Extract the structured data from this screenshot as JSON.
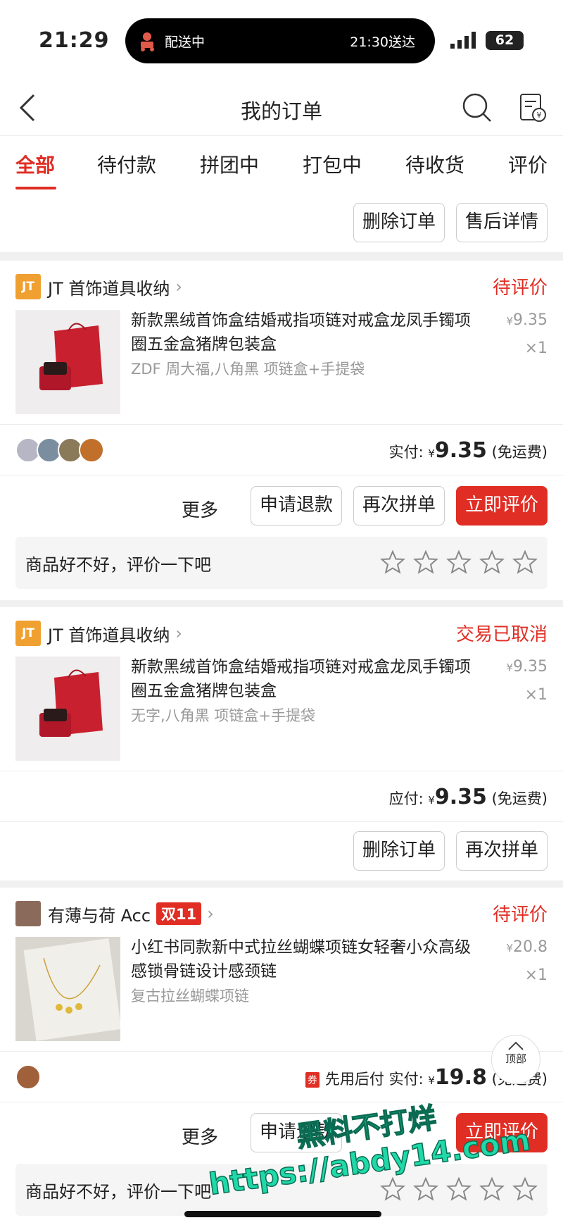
{
  "status_bar": {
    "time": "21:29",
    "activity": "配送中",
    "eta": "21:30送达",
    "battery": "62"
  },
  "nav": {
    "title": "我的订单"
  },
  "tabs": [
    "全部",
    "待付款",
    "拼团中",
    "打包中",
    "待收货",
    "评价"
  ],
  "top_actions": {
    "delete": "删除订单",
    "aftersale": "售后详情"
  },
  "orders": [
    {
      "shop": "JT 首饰道具收纳",
      "shop_logo": "JT",
      "status": "待评价",
      "product_name": "新款黑绒首饰盒结婚戒指项链对戒盒龙凤手镯项圈五金盒猪牌包装盒",
      "spec": "ZDF 周大福,八角黑 项链盒+手提袋",
      "price_symbol": "¥",
      "price": "9.35",
      "qty": "×1",
      "pay_label": "实付:",
      "pay_amount": "9.35",
      "pay_note": "(免运费)",
      "more": "更多",
      "btn_refund": "申请退款",
      "btn_regroup": "再次拼单",
      "btn_review": "立即评价",
      "review_prompt": "商品好不好，评价一下吧"
    },
    {
      "shop": "JT 首饰道具收纳",
      "shop_logo": "JT",
      "status": "交易已取消",
      "product_name": "新款黑绒首饰盒结婚戒指项链对戒盒龙凤手镯项圈五金盒猪牌包装盒",
      "spec": "无字,八角黑 项链盒+手提袋",
      "price_symbol": "¥",
      "price": "9.35",
      "qty": "×1",
      "pay_label": "应付:",
      "pay_amount": "9.35",
      "pay_note": "(免运费)",
      "btn_delete": "删除订单",
      "btn_regroup": "再次拼单"
    },
    {
      "shop": "有薄与荷 Acc",
      "shop_tag": "双11",
      "status": "待评价",
      "product_name": "小红书同款新中式拉丝蝴蝶项链女轻奢小众高级感锁骨链设计感颈链",
      "spec": "复古拉丝蝴蝶项链",
      "price_symbol": "¥",
      "price": "20.8",
      "qty": "×1",
      "paylater_tag": "券",
      "paylater": "先用后付",
      "pay_label": "实付:",
      "pay_amount": "19.8",
      "pay_note": "(免运费)",
      "more": "更多",
      "btn_refund": "申请退款",
      "btn_review": "立即评价",
      "review_prompt": "商品好不好，评价一下吧"
    }
  ],
  "to_top": "顶部",
  "watermark": {
    "line1": "黑料不打烊",
    "line2": "https://abdy14.com"
  },
  "colors": {
    "accent": "#e02e24",
    "muted": "#999999",
    "watermark": "#1fd9a8"
  }
}
